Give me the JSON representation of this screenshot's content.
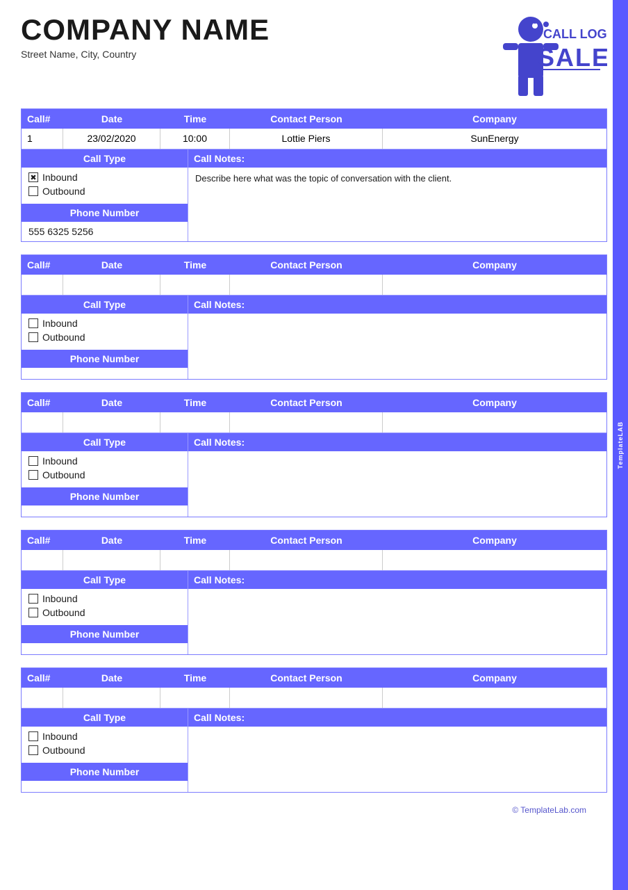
{
  "company": {
    "name": "COMPANY NAME",
    "address": "Street Name, City, Country"
  },
  "logo": {
    "line1": "iCALL LOG",
    "line2": "SALES"
  },
  "templatelab": {
    "stripe_text": "TemplateLAB",
    "footer_link": "© TemplateLab.com"
  },
  "columns": {
    "call_hash": "Call#",
    "date": "Date",
    "time": "Time",
    "contact_person": "Contact Person",
    "company": "Company"
  },
  "labels": {
    "call_type": "Call Type",
    "call_notes": "Call Notes:",
    "inbound": "Inbound",
    "outbound": "Outbound",
    "phone_number": "Phone Number"
  },
  "entries": [
    {
      "call_num": "1",
      "date": "23/02/2020",
      "time": "10:00",
      "contact_person": "Lottie Piers",
      "company": "SunEnergy",
      "inbound_checked": true,
      "outbound_checked": false,
      "phone_number": "555 6325 5256",
      "call_notes": "Describe here what was the topic of conversation with the client."
    },
    {
      "call_num": "",
      "date": "",
      "time": "",
      "contact_person": "",
      "company": "",
      "inbound_checked": false,
      "outbound_checked": false,
      "phone_number": "",
      "call_notes": ""
    },
    {
      "call_num": "",
      "date": "",
      "time": "",
      "contact_person": "",
      "company": "",
      "inbound_checked": false,
      "outbound_checked": false,
      "phone_number": "",
      "call_notes": ""
    },
    {
      "call_num": "",
      "date": "",
      "time": "",
      "contact_person": "",
      "company": "",
      "inbound_checked": false,
      "outbound_checked": false,
      "phone_number": "",
      "call_notes": ""
    },
    {
      "call_num": "",
      "date": "",
      "time": "",
      "contact_person": "",
      "company": "",
      "inbound_checked": false,
      "outbound_checked": false,
      "phone_number": "",
      "call_notes": ""
    }
  ]
}
